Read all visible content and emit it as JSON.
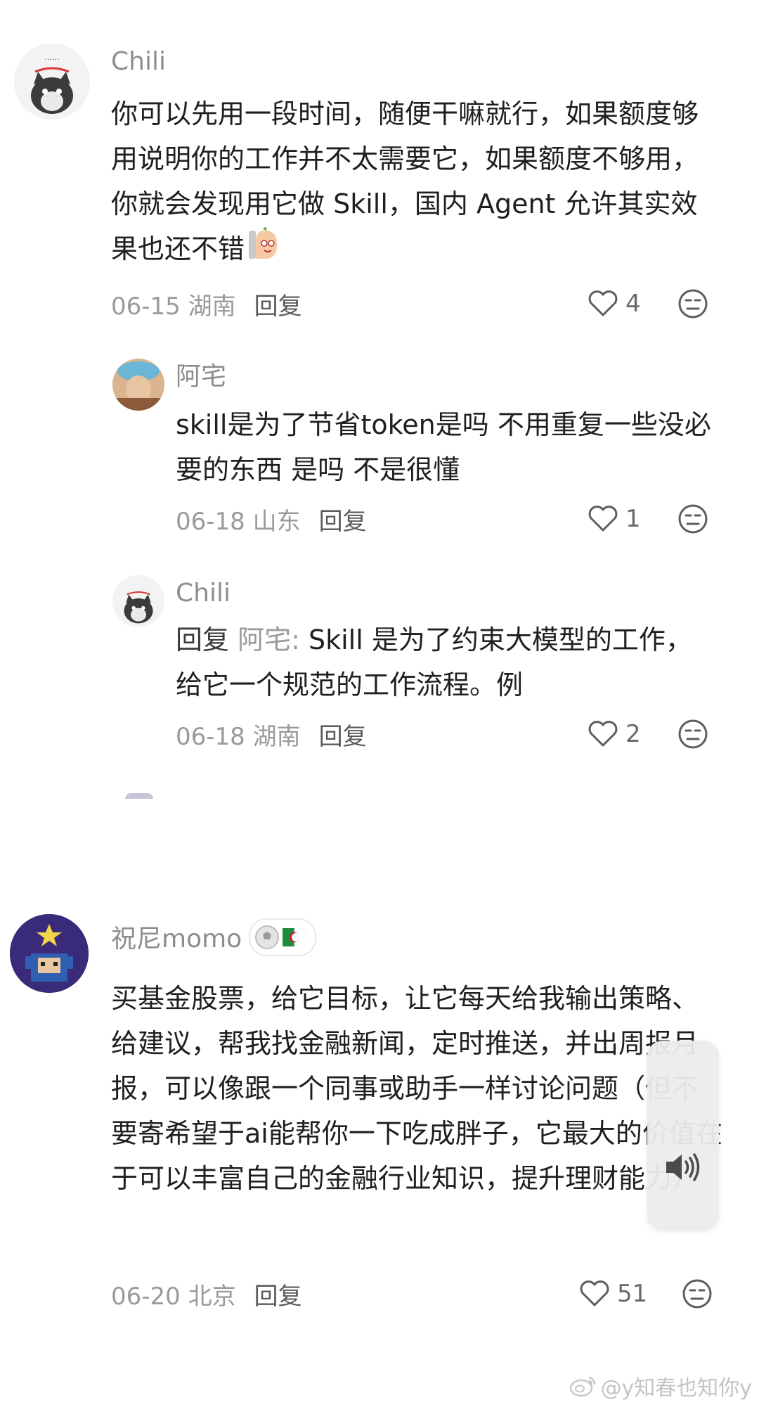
{
  "comments": [
    {
      "username": "Chili",
      "text": "你可以先用一段时间，随便干嘛就行，如果额度够用说明你的工作并不太需要它，如果额度不够用，你就会发现用它做 Skill，国内 Agent 允许其实效果也还不错",
      "date_location": "06-15 湖南",
      "reply_label": "回复",
      "likes": "4",
      "avatar_icon": "cat-avatar"
    },
    {
      "username": "阿宅",
      "text": "skill是为了节省token是吗 不用重复一些没必要的东西 是吗 不是很懂",
      "date_location": "06-18 山东",
      "reply_label": "回复",
      "likes": "1",
      "avatar_icon": "person-avatar"
    },
    {
      "username": "Chili",
      "reply_prefix": "回复",
      "reply_target": "阿宅:",
      "text": " Skill 是为了约束大模型的工作，给它一个规范的工作流程。例",
      "date_location": "06-18 湖南",
      "reply_label": "回复",
      "likes": "2",
      "avatar_icon": "cat-avatar"
    },
    {
      "username": "祝尼momo",
      "text": "买基金股票，给它目标，让它每天给我输出策略、给建议，帮我找金融新闻，定时推送，并出周报月报，可以像跟一个同事或助手一样讨论问题（但不要寄希望于ai能帮你一下吃成胖子，它最大的价值在于可以丰富自己的金融行业知识，提升理财能力）",
      "date_location": "06-20 北京",
      "reply_label": "回复",
      "likes": "51",
      "avatar_icon": "pixel-avatar",
      "badge_icons": [
        "football-icon",
        "algeria-flag-icon"
      ]
    }
  ],
  "watermark": "@y知春也知你y",
  "colors": {
    "meta": "#9a9a9a",
    "text": "#1f1f1f",
    "username": "#8d8d8d"
  }
}
